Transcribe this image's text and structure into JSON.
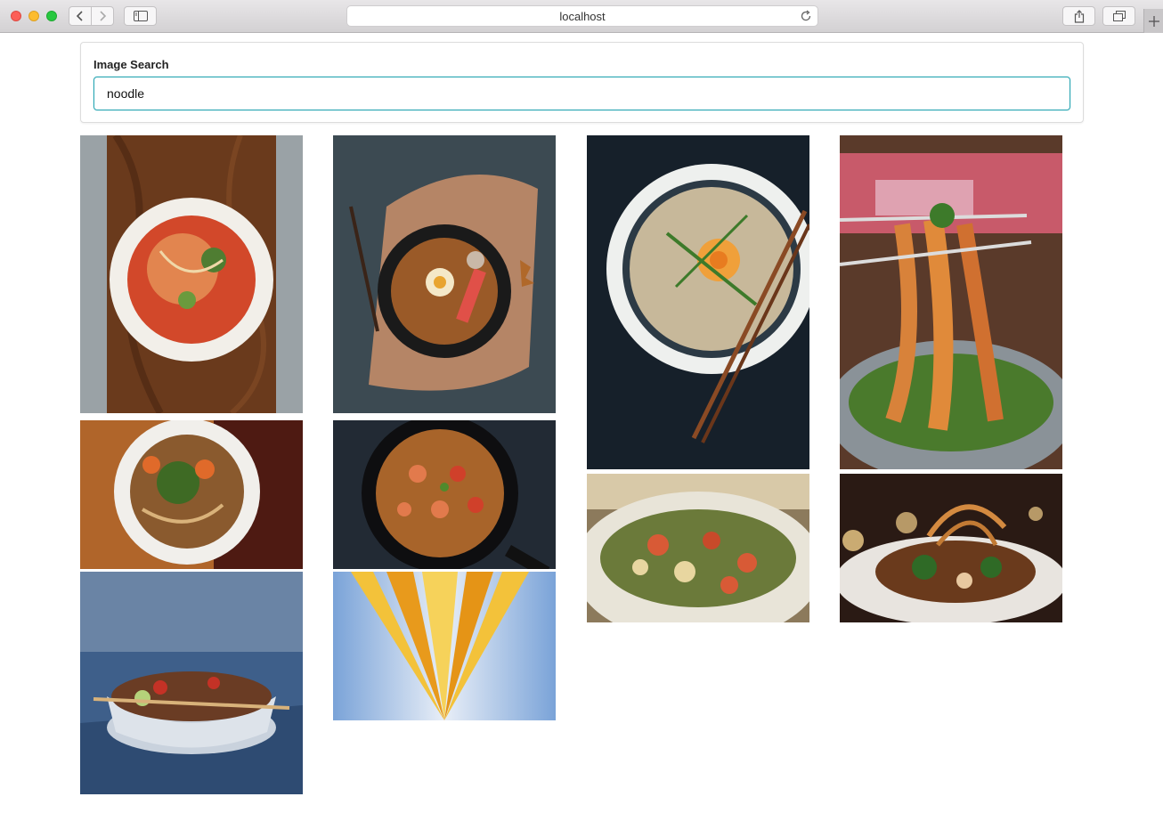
{
  "browser": {
    "url": "localhost",
    "icons": {
      "back": "chevron-left-icon",
      "forward": "chevron-right-icon",
      "sidebar": "sidebar-icon",
      "reload": "reload-icon",
      "share": "share-icon",
      "tabs": "tabs-overview-icon",
      "new_tab": "plus-icon"
    }
  },
  "search": {
    "label": "Image Search",
    "value": "noodle"
  },
  "results": [
    {
      "id": "noodle-soup-wood-board"
    },
    {
      "id": "noodle-bowl-dark-board"
    },
    {
      "id": "ramen-egg-chopsticks"
    },
    {
      "id": "noodles-lifted-chopsticks"
    },
    {
      "id": "noodle-soup-basil"
    },
    {
      "id": "shrimp-spaghetti-pan"
    },
    {
      "id": "tortellini-bowl"
    },
    {
      "id": "crispy-noodle-plate"
    },
    {
      "id": "noodle-bowl-blue-table"
    },
    {
      "id": "raw-spaghetti-strands"
    }
  ]
}
